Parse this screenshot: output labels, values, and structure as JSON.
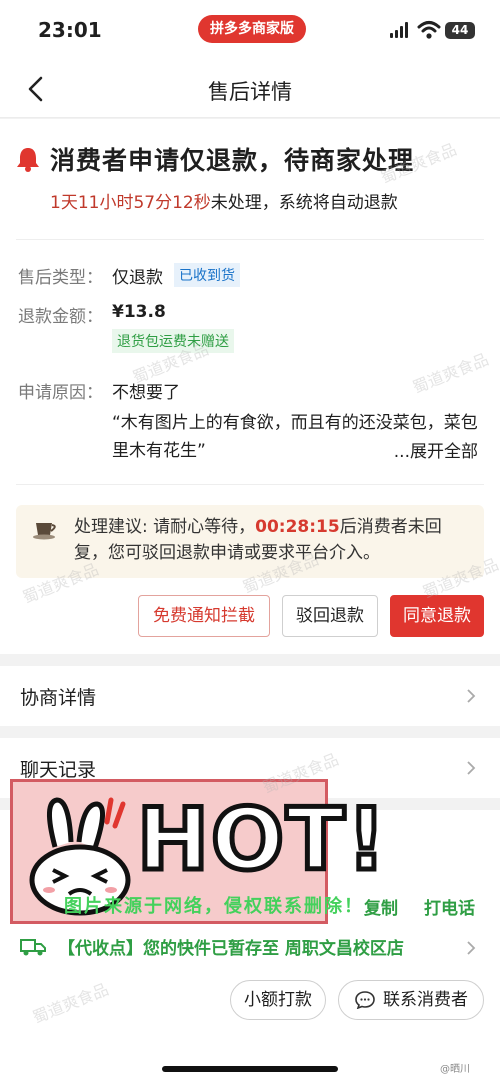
{
  "status_bar": {
    "time": "23:01",
    "merchant_app": "拼多多商家版",
    "battery": "44"
  },
  "nav": {
    "title": "售后详情"
  },
  "header": {
    "headline": "消费者申请仅退款，待商家处理",
    "countdown": "1天11小时57分12秒",
    "countdown_suffix": "未处理，系统将自动退款"
  },
  "details": {
    "type_label": "售后类型：",
    "type_value": "仅退款",
    "type_tag": "已收到货",
    "amount_label": "退款金额：",
    "amount_value": "¥13.8",
    "amount_tag": "退货包运费未赠送",
    "reason_label": "申请原因：",
    "reason_value": "不想要了",
    "reason_quote": "“木有图片上的有食欲，而且有的还没菜包，菜包里木有花生”",
    "expand_label": "...展开全部"
  },
  "advice": {
    "prefix": "处理建议: 请耐心等待，",
    "timer": "00:28:15",
    "suffix": "后消费者未回复，您可驳回退款申请或要求平台介入。"
  },
  "actions": {
    "notify": "免费通知拦截",
    "reject": "驳回退款",
    "agree": "同意退款"
  },
  "sections": {
    "negotiation": "协商详情",
    "chat": "聊天记录"
  },
  "logistics": {
    "copy": "复制",
    "call": "打电话",
    "pickup": "【代收点】您的快件已暂存至 周职文昌校区店"
  },
  "bottom": {
    "small_payment": "小额打款",
    "contact": "联系消费者"
  },
  "overlay": {
    "hot": "HOT!",
    "source_note": "图片来源于网络，侵权联系删除！",
    "weibo": "@晒川"
  },
  "watermark": "蜀道爽食品",
  "colors": {
    "brand_red": "#e0362f",
    "success_green": "#2f9e44",
    "link_blue": "#1a73c9"
  }
}
